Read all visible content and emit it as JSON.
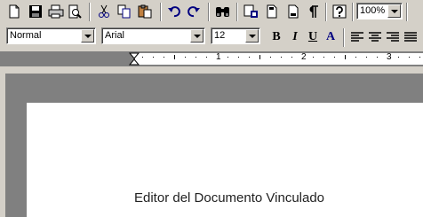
{
  "toolbar": {
    "icons": [
      "new-document",
      "save",
      "print",
      "print-preview",
      "cut",
      "copy",
      "paste",
      "undo",
      "redo",
      "find",
      "insert-link",
      "header",
      "footer",
      "show-formatting",
      "help"
    ],
    "zoom": "100%"
  },
  "format_bar": {
    "style": "Normal",
    "font": "Arial",
    "size": "12",
    "bold": "B",
    "italic": "I",
    "underline": "U",
    "font_color": "A",
    "alignments": [
      "align-left",
      "align-center",
      "align-right",
      "justify"
    ]
  },
  "ruler": {
    "numbers": [
      "1",
      "2",
      "3"
    ]
  },
  "document": {
    "text": "Editor del Documento Vinculado"
  },
  "colors": {
    "chrome": "#d4d0c8",
    "frame": "#808080",
    "accent": "#000080"
  }
}
